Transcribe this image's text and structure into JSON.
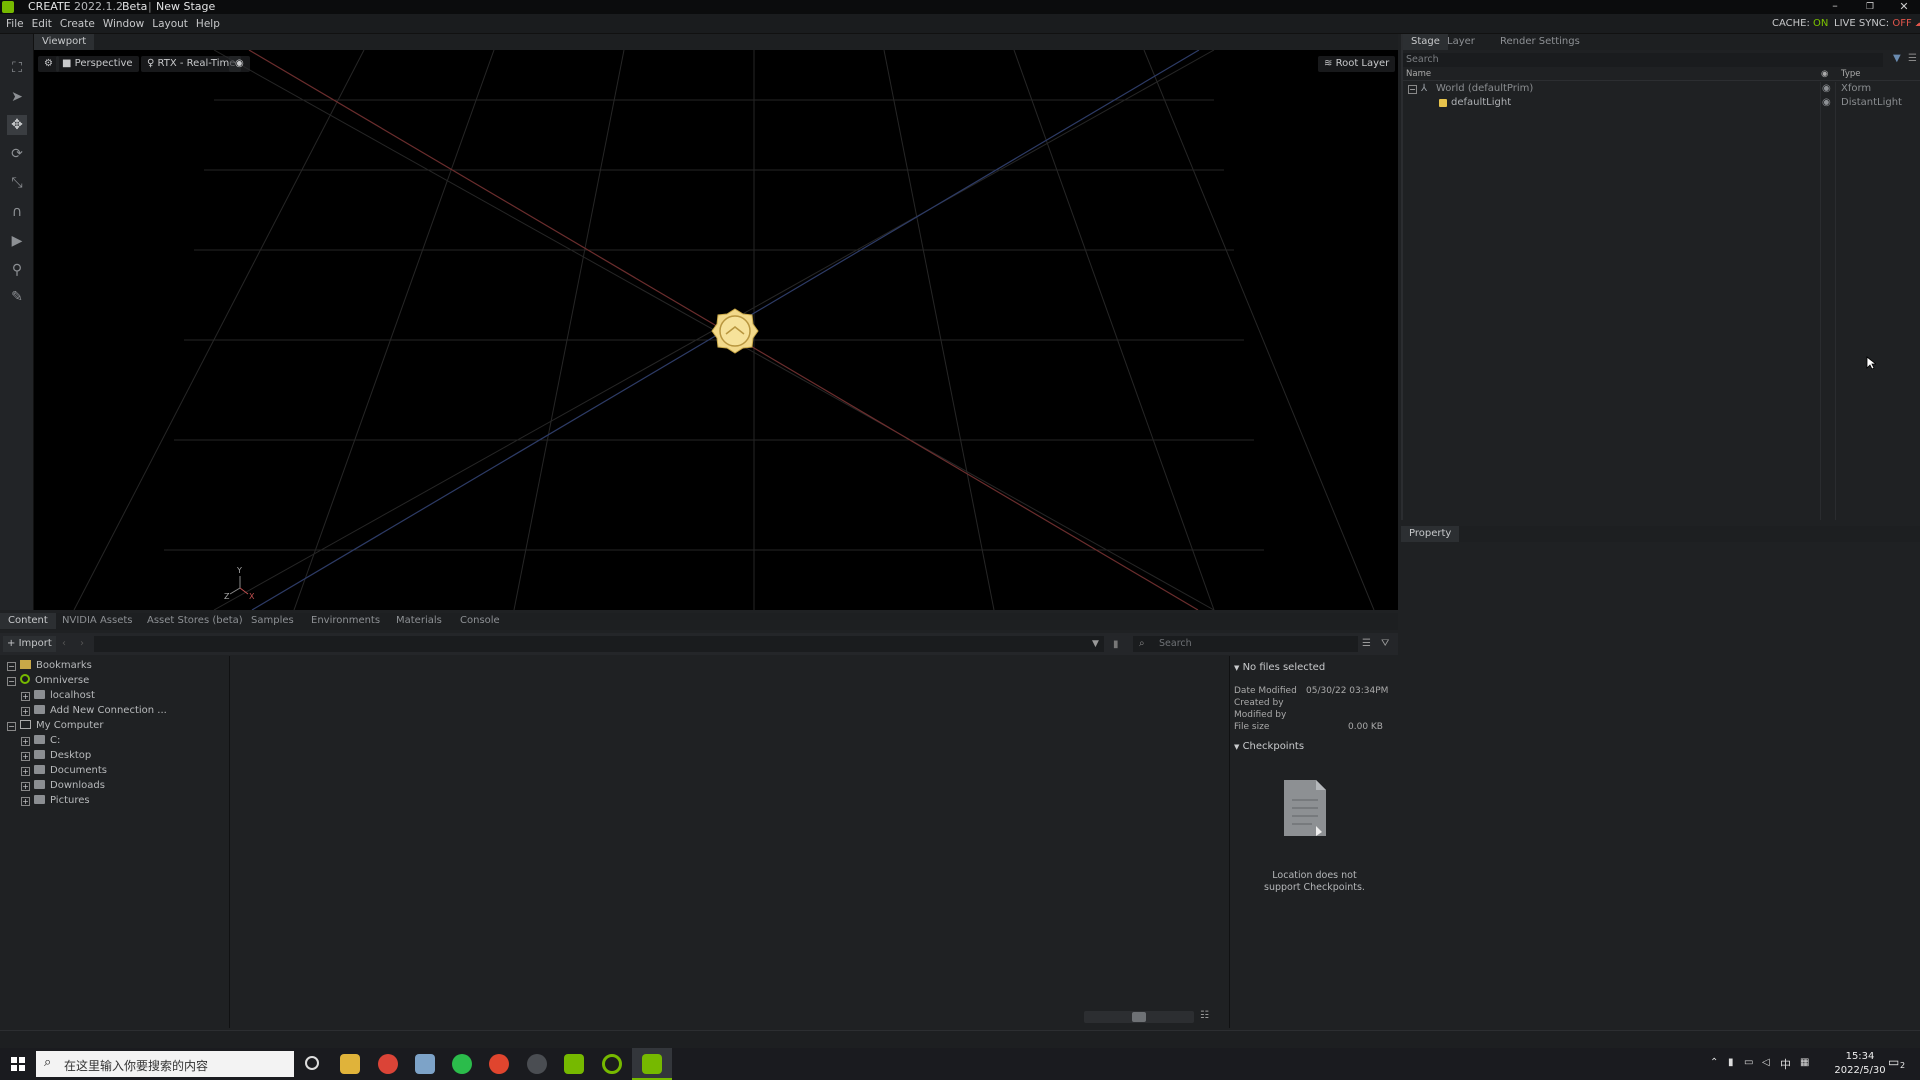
{
  "titlebar": {
    "app": "CREATE",
    "version": "2022.1.2",
    "channel": "Beta",
    "separator": "|",
    "doc": "New Stage"
  },
  "menubar": {
    "items": [
      "File",
      "Edit",
      "Create",
      "Window",
      "Layout",
      "Help"
    ],
    "cache_label": "CACHE:",
    "cache_value": "ON",
    "livesync_label": "LIVE SYNC:",
    "livesync_value": "OFF"
  },
  "colors": {
    "accent_green": "#76b900",
    "on_green": "#7cc400",
    "off_red": "#e0554b",
    "light_gold": "#f2d98a"
  },
  "viewport": {
    "tab": "Viewport",
    "camera": "Perspective",
    "renderer": "RTX - Real-Time",
    "root_layer": "Root Layer",
    "axis_y": "Y",
    "axis_z": "Z",
    "axis_x": "X"
  },
  "stage": {
    "tabs": [
      "Stage",
      "Layer",
      "Render Settings"
    ],
    "search_placeholder": "Search",
    "col_name": "Name",
    "col_type": "Type",
    "rows": [
      {
        "name": "World (defaultPrim)",
        "type": "Xform"
      },
      {
        "name": "defaultLight",
        "type": "DistantLight"
      }
    ]
  },
  "property": {
    "tab": "Property"
  },
  "content": {
    "tabs": [
      "Content",
      "NVIDIA Assets",
      "Asset Stores (beta)",
      "Samples",
      "Environments",
      "Materials",
      "Console"
    ],
    "import_label": "Import",
    "search_placeholder": "Search",
    "tree": [
      {
        "label": "Bookmarks",
        "icon": "bookmark-icon",
        "level": 0,
        "exp": "−"
      },
      {
        "label": "Omniverse",
        "icon": "omniverse-icon",
        "level": 0,
        "exp": "−"
      },
      {
        "label": "localhost",
        "icon": "server-icon",
        "level": 1,
        "exp": "+"
      },
      {
        "label": "Add New Connection ...",
        "icon": "add-connection-icon",
        "level": 1,
        "exp": "+"
      },
      {
        "label": "My Computer",
        "icon": "computer-icon",
        "level": 0,
        "exp": "−"
      },
      {
        "label": "C:",
        "icon": "drive-icon",
        "level": 1,
        "exp": "+"
      },
      {
        "label": "Desktop",
        "icon": "drive-icon",
        "level": 1,
        "exp": "+"
      },
      {
        "label": "Documents",
        "icon": "drive-icon",
        "level": 1,
        "exp": "+"
      },
      {
        "label": "Downloads",
        "icon": "drive-icon",
        "level": 1,
        "exp": "+"
      },
      {
        "label": "Pictures",
        "icon": "drive-icon",
        "level": 1,
        "exp": "+"
      }
    ],
    "detail": {
      "header": "No files selected",
      "date_modified_label": "Date Modified",
      "date_modified_value": "05/30/22 03:34PM",
      "created_by_label": "Created by",
      "modified_by_label": "Modified by",
      "file_size_label": "File size",
      "file_size_value": "0.00 KB",
      "checkpoints_header": "Checkpoints",
      "checkpoints_msg_1": "Location does not",
      "checkpoints_msg_2": "support Checkpoints."
    }
  },
  "taskbar": {
    "search_placeholder": "在这里输入你要搜索的内容",
    "time": "15:34",
    "date": "2022/5/30",
    "ime": "中",
    "notification_count": "2"
  }
}
